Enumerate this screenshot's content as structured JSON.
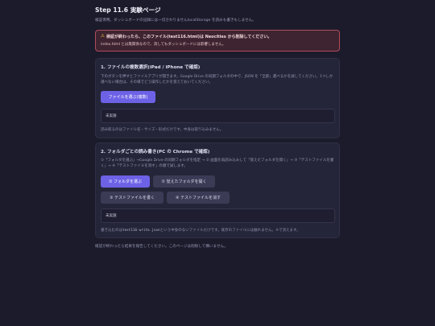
{
  "page": {
    "title": "Step 11.6 実験ページ",
    "subtitle": "検証専用。ダッシュボードの記録には一切さわりませんlocalStorage を読みも書きもしません。"
  },
  "warning": {
    "heading": "検証が終わったら、このファイル(test116.html)は Neocities から削除してください。",
    "text": "index.html とは無関係なので、消してもダッシュボードには影響しません。",
    "icon": "warning-icon"
  },
  "section1": {
    "title": "1. ファイルの複数選択(iPad / iPhone で確認)",
    "desc": "下のボタンを押すとファイルアプリが開きます。Google Drive の同期フォルダの中で、JSON を「全部」選べるかを試してください。1つしか選べない場合は、その場でどう操作したかを覚えておいてください。",
    "button": "ファイルを選ぶ(複数)",
    "status": "未実施",
    "note": "読み取るのはファイル名・サイズ・形式だけです。中身は取り込みません。"
  },
  "section2": {
    "title": "2. フォルダごとの読み書き(PC の Chrome で確認)",
    "desc": "①「フォルダを選ぶ」→Google Drive の同期フォルダを指定 → ② 画面を再読み込みして「覚えたフォルダを開く」→ ③「テストファイルを書く」→ ④「テストファイルを消す」の順で試します。",
    "buttons": {
      "pick_folder": "① フォルダを選ぶ",
      "open_folder": "② 覚えたフォルダを開く",
      "write_file": "③ テストファイルを書く",
      "delete_file": "④ テストファイルを消す"
    },
    "status": "未実施",
    "note_prefix": "書き込むのは",
    "note_code": "test116-write.json",
    "note_suffix": "という中身のないファイルだけです。既存のファイルには触れません。④で消えます。"
  },
  "footer": "確認が終わったら結果を報告してください。このページは削除して構いません。",
  "colors": {
    "background": "#1b1b2b",
    "card": "#252539",
    "primary_button": "#6d62e6",
    "secondary_button": "#3b3b56",
    "warning_bg": "#3d2430",
    "warning_border": "#b34b5c"
  }
}
